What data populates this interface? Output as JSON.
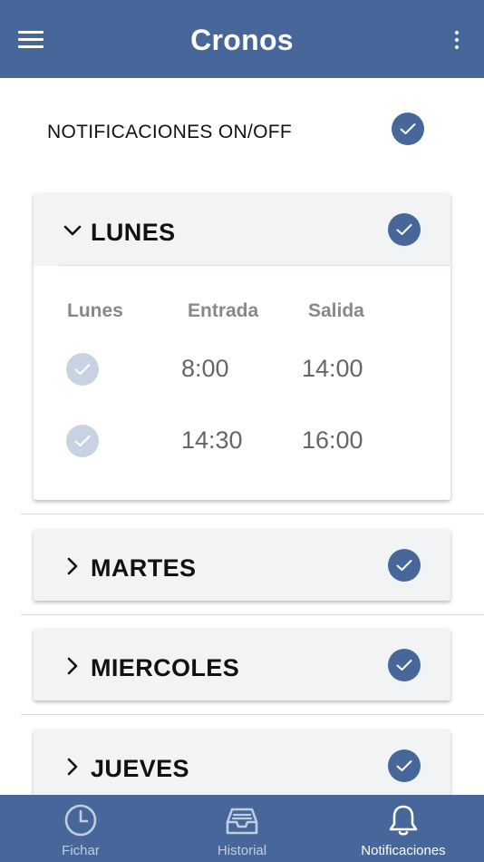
{
  "app": {
    "title": "Cronos"
  },
  "icons": {
    "menu": "hamburger-menu-icon",
    "more": "more-vertical-icon"
  },
  "colors": {
    "primary": "#47679a",
    "check_disabled": "#c7d2e2",
    "card_header_bg": "#f2f3f5"
  },
  "notifications": {
    "label": "NOTIFICACIONES ON/OFF",
    "enabled": true
  },
  "days": [
    {
      "name": "LUNES",
      "expanded": true,
      "checked": true,
      "table": {
        "headers": [
          "Lunes",
          "Entrada",
          "Salida"
        ],
        "rows": [
          {
            "checked": true,
            "entrada": "8:00",
            "salida": "14:00"
          },
          {
            "checked": true,
            "entrada": "14:30",
            "salida": "16:00"
          }
        ]
      }
    },
    {
      "name": "MARTES",
      "expanded": false,
      "checked": true
    },
    {
      "name": "MIERCOLES",
      "expanded": false,
      "checked": true
    },
    {
      "name": "JUEVES",
      "expanded": false,
      "checked": true
    }
  ],
  "tabs": [
    {
      "label": "Fichar",
      "icon": "clock-icon",
      "active": false
    },
    {
      "label": "Historial",
      "icon": "inbox-tray-icon",
      "active": false
    },
    {
      "label": "Notificaciones",
      "icon": "bell-icon",
      "active": true
    }
  ]
}
